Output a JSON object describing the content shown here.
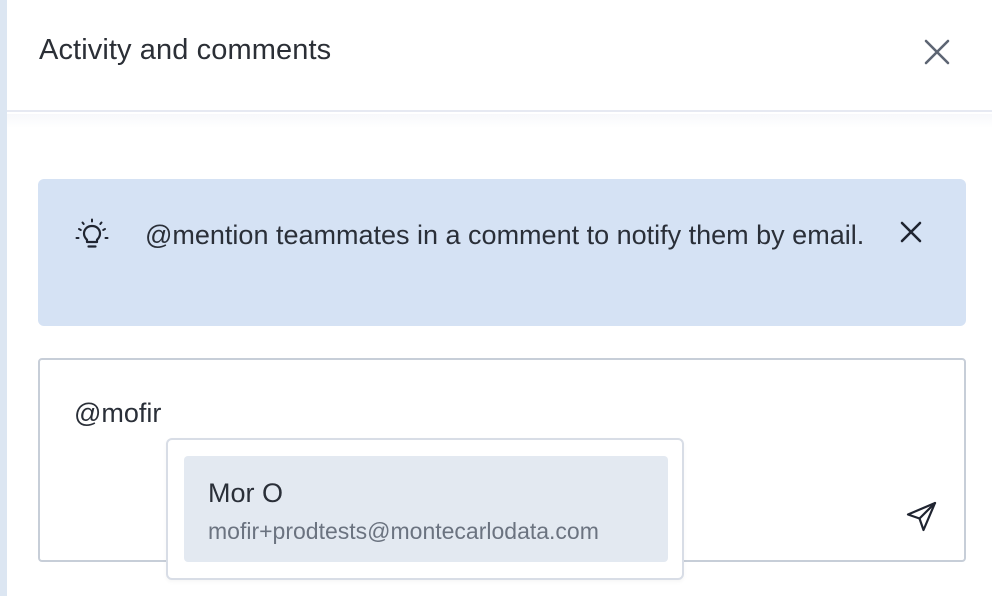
{
  "panel": {
    "title": "Activity and comments",
    "close_icon": "close-icon"
  },
  "tip": {
    "icon": "lightbulb-icon",
    "text": "@mention teammates in a comment to notify them by email.",
    "dismiss_icon": "close-icon"
  },
  "comment": {
    "value": "@mofir",
    "send_icon": "send-icon"
  },
  "mention_suggestions": [
    {
      "name": "Mor O",
      "email": "mofir+prodtests@montecarlodata.com"
    }
  ],
  "colors": {
    "tip_background": "#d5e2f4",
    "suggestion_highlight": "#e3e9f1",
    "border": "#c7ced8"
  }
}
